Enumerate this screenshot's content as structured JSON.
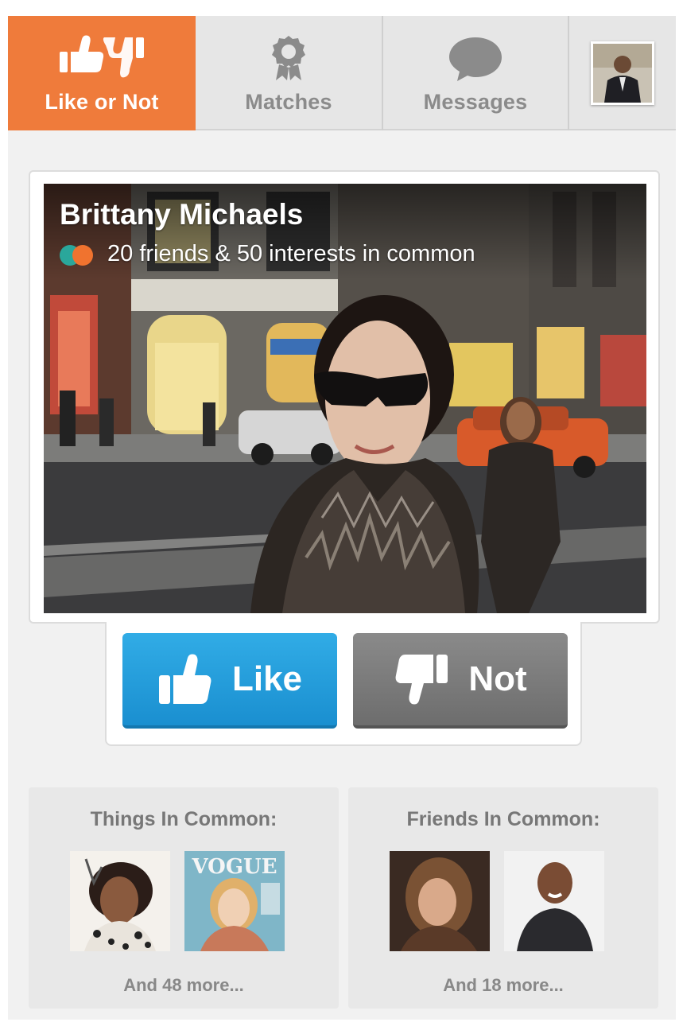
{
  "nav": {
    "tabs": [
      {
        "label": "Like or Not",
        "icon": "thumbs-up-down-icon",
        "active": true
      },
      {
        "label": "Matches",
        "icon": "award-ribbon-icon",
        "active": false
      },
      {
        "label": "Messages",
        "icon": "speech-bubble-icon",
        "active": false
      }
    ],
    "profile_icon": "user-avatar",
    "accent_color": "#ef7b3b"
  },
  "profile": {
    "name": "Brittany Michaels",
    "common_summary": "20 friends & 50 interests in common",
    "dot_colors": [
      "#2aa79b",
      "#f0732f"
    ]
  },
  "actions": {
    "like_label": "Like",
    "like_color": "#2a9fdc",
    "not_label": "Not",
    "not_color": "#7b7b7b"
  },
  "things_in_common": {
    "title": "Things In Common:",
    "items": [
      "music-artist-photo",
      "magazine-cover-photo"
    ],
    "more": "And 48 more..."
  },
  "friends_in_common": {
    "title": "Friends In Common:",
    "items": [
      "friend-photo",
      "friend-photo"
    ],
    "more": "And 18 more..."
  }
}
